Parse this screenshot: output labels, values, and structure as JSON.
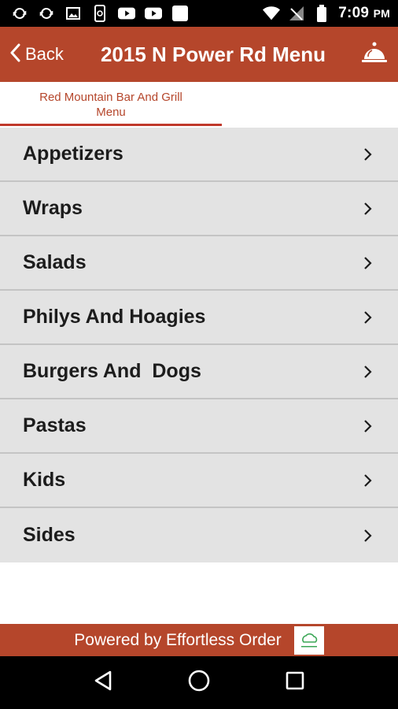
{
  "status_bar": {
    "time": "7:09",
    "ampm": "PM",
    "icons": [
      "sync-icon",
      "sync-icon",
      "image-icon",
      "phone-icon",
      "youtube-icon",
      "youtube-icon",
      "square-icon",
      "wifi-icon",
      "signal-icon",
      "battery-icon"
    ]
  },
  "app_bar": {
    "back_label": "Back",
    "title": "2015 N Power Rd Menu",
    "right_icon": "service-bell-icon"
  },
  "tabs": [
    {
      "label": "Red Mountain Bar And Grill Menu",
      "selected": true
    }
  ],
  "menu": {
    "items": [
      {
        "label": "Appetizers"
      },
      {
        "label": "Wraps"
      },
      {
        "label": "Salads"
      },
      {
        "label": "Philys And Hoagies"
      },
      {
        "label": "Burgers And  Dogs"
      },
      {
        "label": "Pastas"
      },
      {
        "label": "Kids"
      },
      {
        "label": "Sides"
      }
    ]
  },
  "footer": {
    "text": "Powered by Effortless Order",
    "logo_icon": "effortless-order-logo"
  },
  "nav_bar": {
    "buttons": [
      "back-triangle-icon",
      "home-circle-icon",
      "recents-square-icon"
    ]
  },
  "colors": {
    "brand": "#b5462b",
    "tab_text": "#b5462b",
    "tab_indicator": "#c0392b",
    "list_bg": "#e3e3e3"
  }
}
